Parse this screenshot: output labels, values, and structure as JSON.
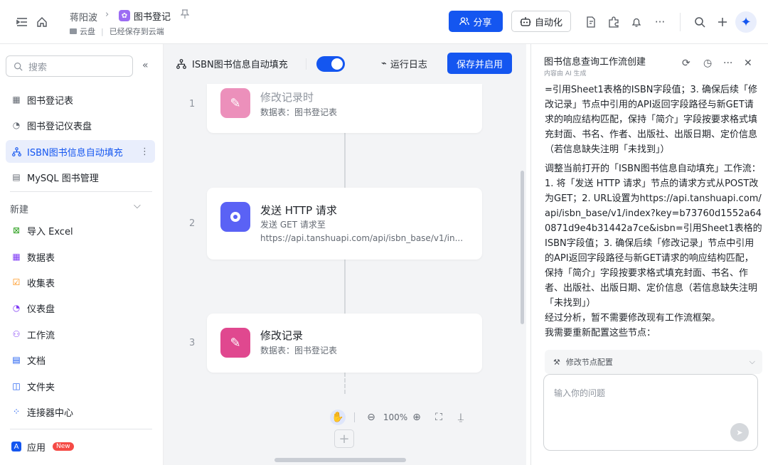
{
  "header": {
    "breadcrumb_user": "蒋阳波",
    "breadcrumb_sep": "›",
    "doc_title": "图书登记",
    "location": "云盘",
    "save_status": "已经保存到云端",
    "share_label": "分享",
    "automation_label": "自动化"
  },
  "sidebar": {
    "search_placeholder": "搜索",
    "items": [
      {
        "label": "图书登记表"
      },
      {
        "label": "图书登记仪表盘"
      },
      {
        "label": "ISBN图书信息自动填充"
      },
      {
        "label": "MySQL 图书管理"
      }
    ],
    "new_section_label": "新建",
    "new_items": [
      {
        "label": "导入 Excel"
      },
      {
        "label": "数据表"
      },
      {
        "label": "收集表"
      },
      {
        "label": "仪表盘"
      },
      {
        "label": "工作流"
      },
      {
        "label": "文档"
      },
      {
        "label": "文件夹"
      },
      {
        "label": "连接器中心"
      }
    ],
    "apps_label": "应用",
    "apps_badge": "New"
  },
  "workflow": {
    "title": "ISBN图书信息自动填充",
    "enabled": true,
    "run_log_label": "运行日志",
    "save_enable_label": "保存并启用",
    "steps": [
      {
        "num": "1",
        "title": "修改记录时",
        "sub": "数据表：图书登记表"
      },
      {
        "num": "2",
        "title": "发送 HTTP 请求",
        "sub": "发送 GET 请求至",
        "sub2": "https://api.tanshuapi.com/api/isbn_base/v1/in..."
      },
      {
        "num": "3",
        "title": "修改记录",
        "sub": "数据表：图书登记表"
      }
    ],
    "zoom": "100%"
  },
  "panel": {
    "title": "图书信息查询工作流创建",
    "subtitle": "内容由 AI 生成",
    "para1": "=引用Sheet1表格的ISBN字段值；3. 确保后续「修改记录」节点中引用的API返回字段路径与新GET请求的响应结构匹配，保持「简介」字段按要求格式填充封面、书名、作者、出版社、出版日期、定价信息（若信息缺失注明「未找到」）",
    "para2": "调整当前打开的「ISBN图书信息自动填充」工作流：1. 将「发送 HTTP 请求」节点的请求方式从POST改为GET；2. URL设置为https://api.tanshuapi.com/api/isbn_base/v1/index?key=b73760d1552a640871d9e4b31442a7ce&isbn=引用Sheet1表格的ISBN字段值；3. 确保后续「修改记录」节点中引用的API返回字段路径与新GET请求的响应结构匹配，保持「简介」字段按要求格式填充封面、书名、作者、出版社、出版日期、定价信息（若信息缺失注明「未找到」）",
    "para3": "经过分析，暂不需要修改现有工作流框架。",
    "para4": "我需要重新配置这些节点：",
    "node_cfg_label": "修改节点配置",
    "input_placeholder": "输入你的问题"
  },
  "colors": {
    "accent": "#1456f0",
    "record_icon": "#e0488f",
    "http_icon": "#5a62f5"
  }
}
